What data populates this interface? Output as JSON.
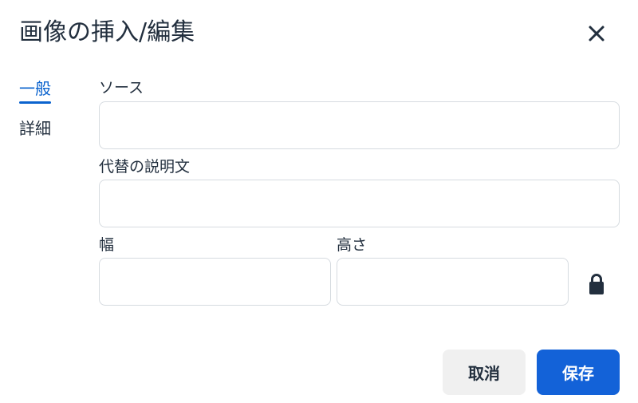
{
  "dialog": {
    "title": "画像の挿入/編集",
    "close_icon": "close-icon"
  },
  "tabs": [
    {
      "label": "一般",
      "active": true
    },
    {
      "label": "詳細",
      "active": false
    }
  ],
  "form": {
    "source": {
      "label": "ソース",
      "value": "",
      "placeholder": ""
    },
    "alt": {
      "label": "代替の説明文",
      "value": "",
      "placeholder": ""
    },
    "width": {
      "label": "幅",
      "value": "",
      "placeholder": ""
    },
    "height": {
      "label": "高さ",
      "value": "",
      "placeholder": ""
    },
    "constrain_icon": "lock-icon"
  },
  "buttons": {
    "cancel": "取消",
    "save": "保存"
  },
  "colors": {
    "accent": "#0b63ce",
    "primary_button": "#1362d8",
    "secondary_button": "#f0f0f0",
    "text": "#222f3e",
    "border": "#d6dbe0"
  }
}
